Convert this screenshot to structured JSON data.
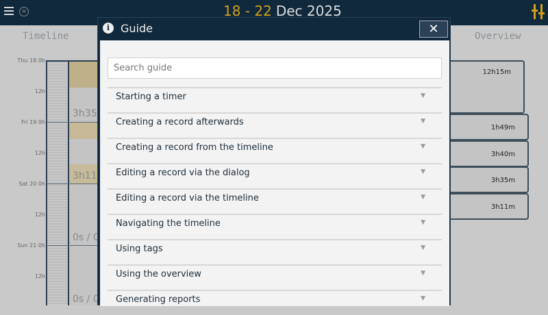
{
  "header": {
    "date_range": "18 - 22",
    "month_year": "Dec 2025"
  },
  "timeline": {
    "title": "Timeline",
    "labels": [
      "Thu 18  0h",
      "12h",
      "Fri 19  0h",
      "12h",
      "Sat 20  0h",
      "12h",
      "Sun 21  0h",
      "12h"
    ],
    "durations": [
      "3h35m",
      "3h11m",
      "0s / 0",
      "0s / 0"
    ]
  },
  "overview": {
    "title": "Overview",
    "total": "12h15m",
    "days": [
      "1h49m",
      "3h40m",
      "3h35m",
      "3h11m"
    ]
  },
  "guide": {
    "title": "Guide",
    "close_label": "✕",
    "search_placeholder": "Search guide",
    "items": [
      "Starting a timer",
      "Creating a record afterwards",
      "Creating a record from the timeline",
      "Editing a record via the dialog",
      "Editing a record via the timeline",
      "Navigating the timeline",
      "Using tags",
      "Using the overview",
      "Generating reports"
    ]
  },
  "colors": {
    "accent": "#d4a017",
    "dark": "#10293d"
  }
}
